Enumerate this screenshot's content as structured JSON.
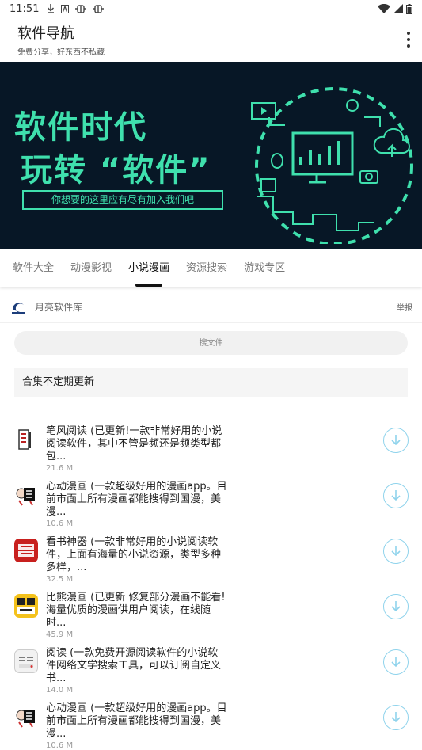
{
  "status_bar": {
    "time": "11:51",
    "left_icons": [
      "download-icon",
      "a-icon",
      "bug-icon",
      "bug-icon"
    ],
    "right_icons": [
      "wifi-icon",
      "signal-icon",
      "battery-icon"
    ]
  },
  "app_bar": {
    "title": "软件导航",
    "subtitle": "免费分享，好东西不私藏"
  },
  "banner": {
    "line1": "软件时代",
    "line2": "玩转 “软件”",
    "tagline": "你想要的这里应有尽有加入我们吧",
    "accent_color": "#3fe0ad",
    "bg_color": "#071726"
  },
  "tabs": [
    {
      "label": "软件大全",
      "active": false
    },
    {
      "label": "动漫影视",
      "active": false
    },
    {
      "label": "小说漫画",
      "active": true
    },
    {
      "label": "资源搜索",
      "active": false
    },
    {
      "label": "游戏专区",
      "active": false
    }
  ],
  "publisher": {
    "name": "月亮软件库",
    "report_label": "举报"
  },
  "search": {
    "placeholder": "搜文件"
  },
  "collection_note": "合集不定期更新",
  "apps": [
    {
      "desc": "笔风阅读 (已更新!一款非常好用的小说阅读软件，其中不管是频还是频类型都包...",
      "size": "21.6 M",
      "icon": "bifeng-icon"
    },
    {
      "desc": "心动漫画 (一款超级好用的漫画app。目前市面上所有漫画都能搜得到国漫，美漫...",
      "size": "10.6 M",
      "icon": "xindong-icon"
    },
    {
      "desc": "看书神器 (一款非常好用的小说阅读软件，上面有海量的小说资源，类型多种多样，...",
      "size": "32.5 M",
      "icon": "kanshu-icon"
    },
    {
      "desc": "比熊漫画 (已更新 修复部分漫画不能看!海量优质的漫画供用户阅读，在线随时...",
      "size": "45.9 M",
      "icon": "bixiong-icon"
    },
    {
      "desc": "阅读 (一款免费开源阅读软件的小说软件网络文学搜索工具，可以订阅自定义书...",
      "size": "14.0 M",
      "icon": "yuedu-icon"
    },
    {
      "desc": "心动漫画 (一款超级好用的漫画app。目前市面上所有漫画都能搜得到国漫，美漫...",
      "size": "10.6 M",
      "icon": "xindong-icon"
    }
  ],
  "colors": {
    "download_ring": "#8fd3ec",
    "tab_indicator": "#111111"
  }
}
